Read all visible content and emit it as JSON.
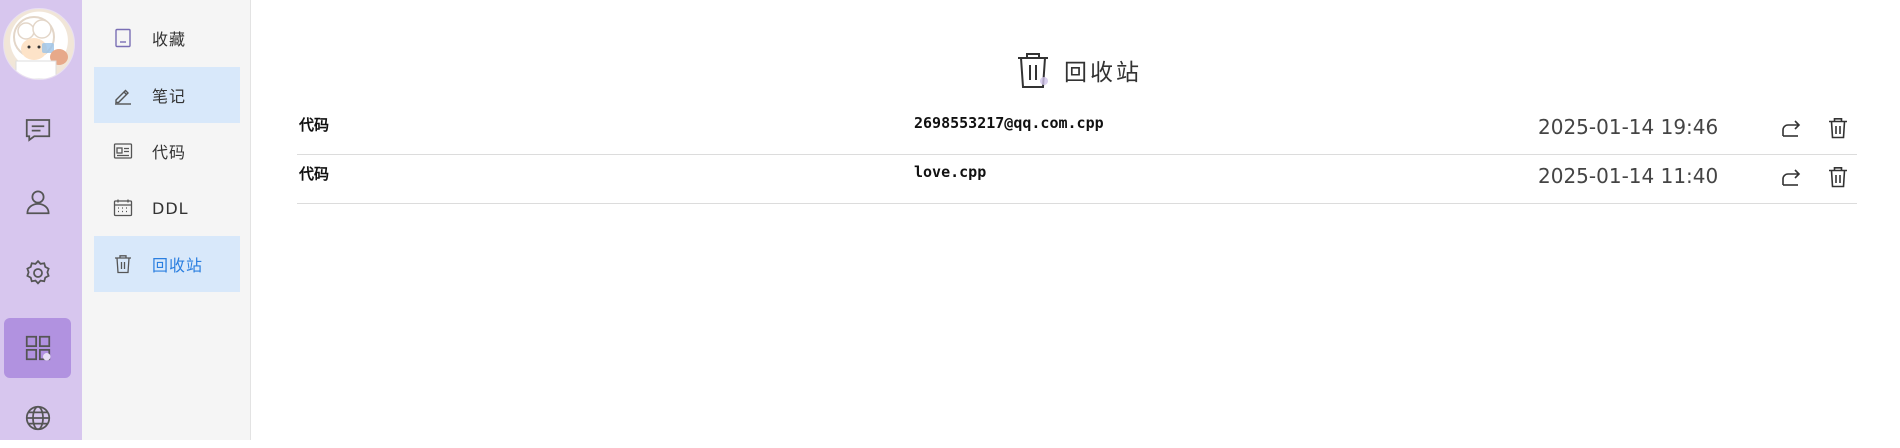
{
  "rail": {
    "items": [
      {
        "icon": "chat-icon"
      },
      {
        "icon": "user-icon"
      },
      {
        "icon": "gear-icon"
      },
      {
        "icon": "grid-apps-icon",
        "active": true
      },
      {
        "icon": "globe-icon"
      }
    ]
  },
  "menu": {
    "items": [
      {
        "label": "收藏",
        "icon": "bookmark-icon"
      },
      {
        "label": "笔记",
        "icon": "pencil-icon",
        "selected": true
      },
      {
        "label": "代码",
        "icon": "code-card-icon"
      },
      {
        "label": "DDL",
        "icon": "calendar-icon"
      },
      {
        "label": "回收站",
        "icon": "trash-icon",
        "selected": true,
        "active": true
      }
    ]
  },
  "page": {
    "title": "回收站"
  },
  "rows": [
    {
      "category": "代码",
      "name": "2698553217@qq.com.cpp",
      "time": "2025-01-14 19:46"
    },
    {
      "category": "代码",
      "name": "love.cpp",
      "time": "2025-01-14 11:40"
    }
  ],
  "colors": {
    "rail_bg": "#d7c6ee",
    "rail_active": "#b192e0",
    "menu_selected": "#d8e8fa",
    "menu_active_text": "#2b7fe0"
  }
}
